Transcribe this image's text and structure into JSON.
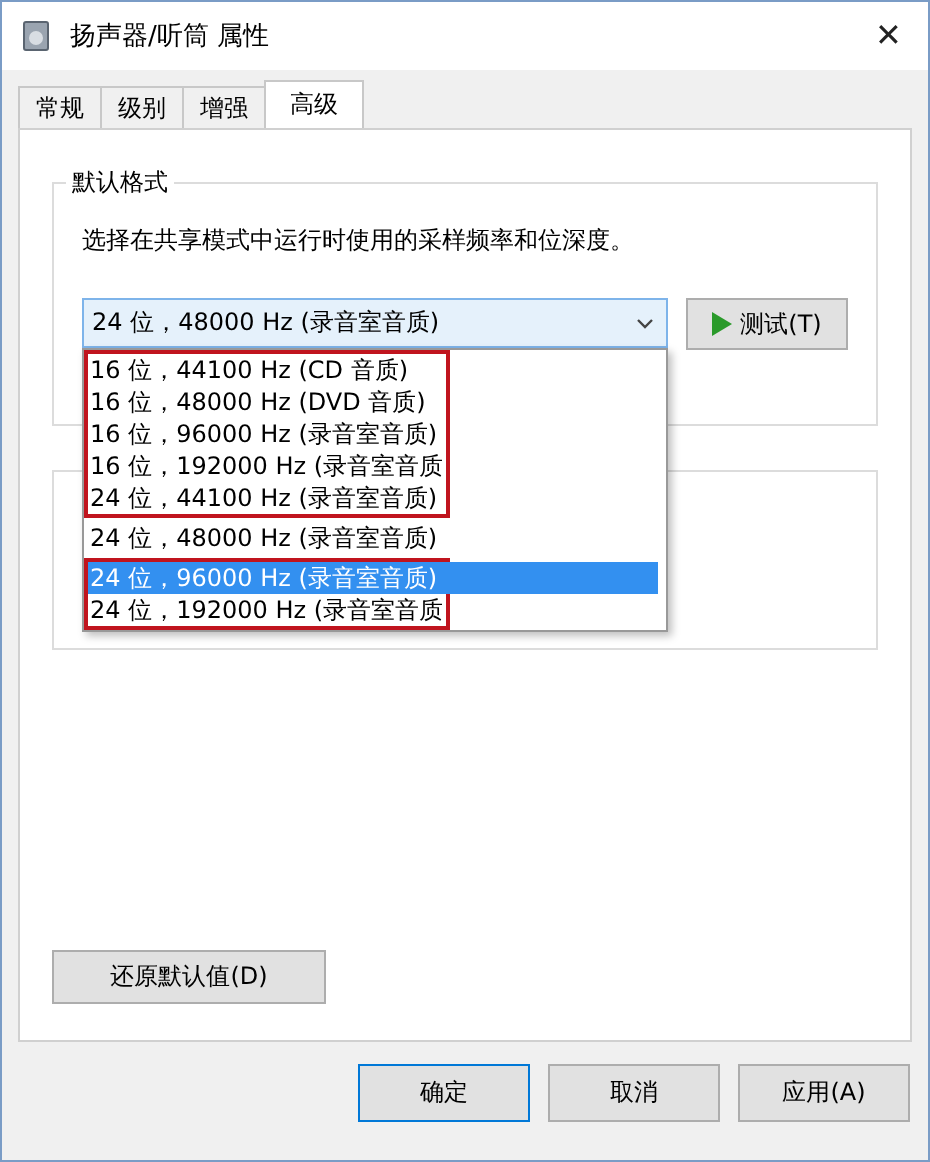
{
  "window": {
    "title": "扬声器/听筒 属性",
    "close": "✕"
  },
  "tabs": [
    {
      "label": "常规",
      "selected": false
    },
    {
      "label": "级别",
      "selected": false
    },
    {
      "label": "增强",
      "selected": false
    },
    {
      "label": "高级",
      "selected": true
    }
  ],
  "default_format": {
    "title": "默认格式",
    "description": "选择在共享模式中运行时使用的采样频率和位深度。",
    "dropdown": {
      "value": "24 位，48000 Hz (录音室音质)",
      "expanded": true,
      "option_groups": [
        {
          "outlined": true,
          "options": [
            {
              "label": "16 位，44100 Hz (CD 音质)",
              "selected": false
            },
            {
              "label": "16 位，48000 Hz (DVD 音质)",
              "selected": false
            },
            {
              "label": "16 位，96000 Hz (录音室音质)",
              "selected": false
            },
            {
              "label": "16 位，192000 Hz (录音室音质",
              "selected": false
            },
            {
              "label": "24 位，44100 Hz (录音室音质)",
              "selected": false
            }
          ]
        },
        {
          "outlined": false,
          "options": [
            {
              "label": "24 位，48000 Hz (录音室音质)",
              "selected": false
            }
          ]
        },
        {
          "outlined": true,
          "options": [
            {
              "label": "24 位，96000 Hz (录音室音质)",
              "selected": true
            },
            {
              "label": "24 位，192000 Hz (录音室音质",
              "selected": false
            }
          ]
        }
      ]
    },
    "test_button": "测试(T)"
  },
  "restore_button": "还原默认值(D)",
  "buttons": [
    "确定",
    "取消",
    "应用(A)"
  ]
}
